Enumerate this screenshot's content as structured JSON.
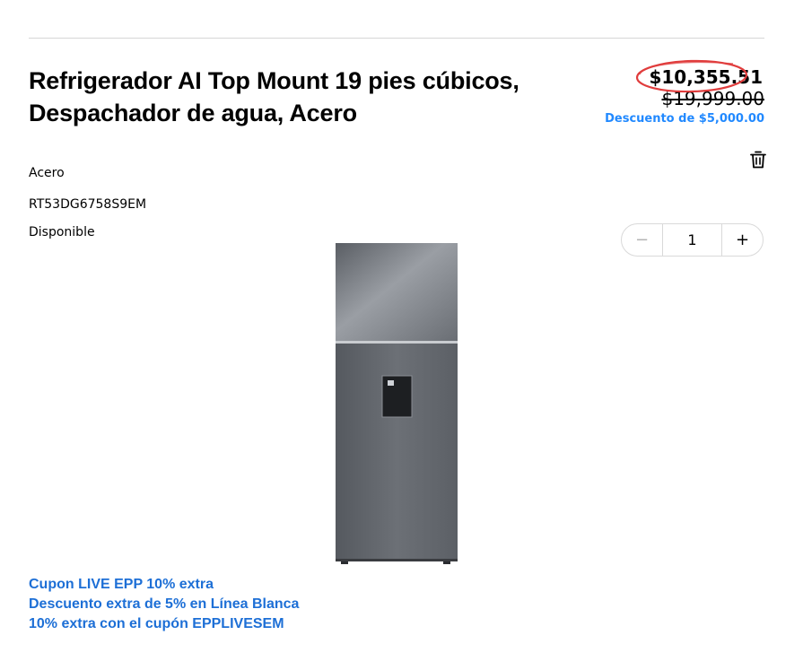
{
  "product": {
    "title": "Refrigerador AI Top Mount 19 pies cúbicos, Despachador de agua, Acero",
    "color": "Acero",
    "model": "RT53DG6758S9EM",
    "availability": "Disponible",
    "image_icon": "refrigerator-image"
  },
  "pricing": {
    "price": "$10,355.51",
    "original_price": "$19,999.00",
    "discount": "Descuento de $5,000.00",
    "price_highlight_color": "#e03c3c",
    "discount_color": "#2189ff"
  },
  "actions": {
    "remove_icon": "trash-icon"
  },
  "quantity": {
    "minus": "−",
    "value": "1",
    "plus": "+"
  },
  "promotions": [
    "Cupon LIVE EPP 10% extra",
    "Descuento extra de 5% en Línea Blanca",
    "10% extra con el cupón EPPLIVESEM"
  ]
}
